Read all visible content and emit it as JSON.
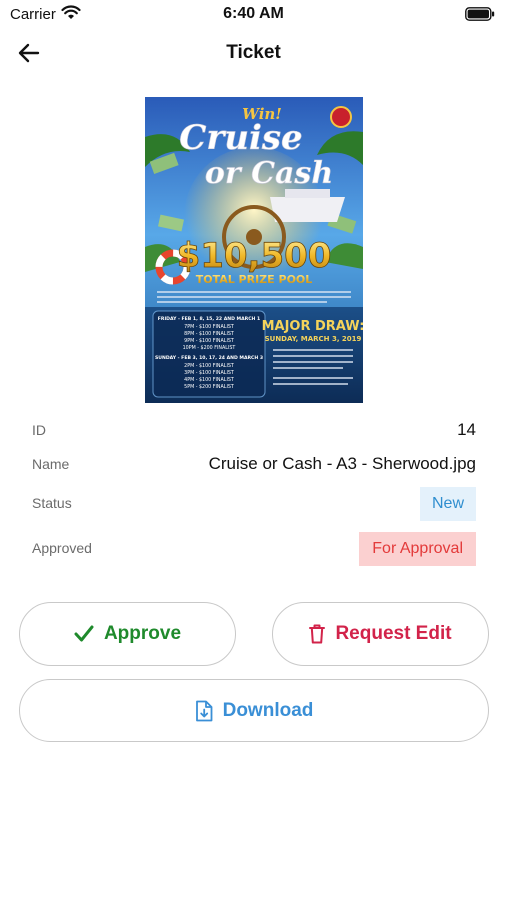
{
  "status_bar": {
    "carrier": "Carrier",
    "time": "6:40 AM"
  },
  "header": {
    "title": "Ticket"
  },
  "poster": {
    "win": "Win!",
    "line1": "Cruise",
    "line2": "or Cash",
    "amount": "$10,500",
    "prize_label": "TOTAL PRIZE POOL",
    "friday_header": "FRIDAY - FEB 1, 8, 15, 22 AND MARCH 1",
    "friday_lines": [
      "7PM - $100 FINALIST",
      "8PM - $100 FINALIST",
      "9PM - $100 FINALIST",
      "10PM - $200 FINALIST"
    ],
    "sunday_header": "SUNDAY - FEB 3, 10, 17, 24 AND MARCH 3",
    "sunday_lines": [
      "2PM - $100 FINALIST",
      "3PM - $100 FINALIST",
      "4PM - $100 FINALIST",
      "5PM - $200 FINALIST"
    ],
    "major_draw": "MAJOR DRAW:",
    "major_date": "SUNDAY, MARCH 3, 2019"
  },
  "details": {
    "id_label": "ID",
    "id_value": "14",
    "name_label": "Name",
    "name_value": "Cruise or Cash - A3 - Sherwood.jpg",
    "status_label": "Status",
    "status_value": "New",
    "approved_label": "Approved",
    "approved_value": "For Approval"
  },
  "actions": {
    "approve": "Approve",
    "request_edit": "Request Edit",
    "download": "Download"
  },
  "colors": {
    "approve": "#1f8a2c",
    "request_edit": "#d2234a",
    "download": "#3a8fd6",
    "status_bg": "#e4f1fb",
    "status_text": "#2f8ecf",
    "approval_bg": "#fbd0d0",
    "approval_text": "#e33a3a"
  },
  "icons": {
    "back": "arrow-left-icon",
    "approve": "check-icon",
    "request_edit": "trash-icon",
    "download": "file-download-icon"
  }
}
